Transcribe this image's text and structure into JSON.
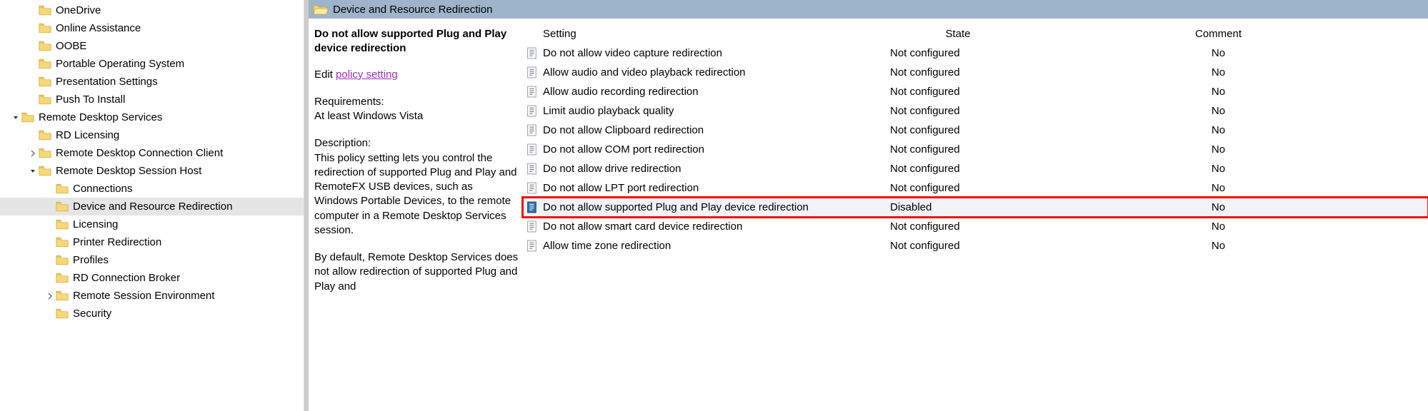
{
  "tree": [
    {
      "indent": 1,
      "exp": "none",
      "label": "OneDrive"
    },
    {
      "indent": 1,
      "exp": "none",
      "label": "Online Assistance"
    },
    {
      "indent": 1,
      "exp": "none",
      "label": "OOBE"
    },
    {
      "indent": 1,
      "exp": "none",
      "label": "Portable Operating System"
    },
    {
      "indent": 1,
      "exp": "none",
      "label": "Presentation Settings"
    },
    {
      "indent": 1,
      "exp": "none",
      "label": "Push To Install"
    },
    {
      "indent": 0,
      "exp": "open",
      "label": "Remote Desktop Services"
    },
    {
      "indent": 1,
      "exp": "none",
      "label": "RD Licensing"
    },
    {
      "indent": 1,
      "exp": "closed",
      "label": "Remote Desktop Connection Client"
    },
    {
      "indent": 1,
      "exp": "open",
      "label": "Remote Desktop Session Host"
    },
    {
      "indent": 2,
      "exp": "none",
      "label": "Connections"
    },
    {
      "indent": 2,
      "exp": "none",
      "label": "Device and Resource Redirection",
      "selected": true
    },
    {
      "indent": 2,
      "exp": "none",
      "label": "Licensing"
    },
    {
      "indent": 2,
      "exp": "none",
      "label": "Printer Redirection"
    },
    {
      "indent": 2,
      "exp": "none",
      "label": "Profiles"
    },
    {
      "indent": 2,
      "exp": "none",
      "label": "RD Connection Broker"
    },
    {
      "indent": 2,
      "exp": "closed",
      "label": "Remote Session Environment"
    },
    {
      "indent": 2,
      "exp": "none",
      "label": "Security"
    }
  ],
  "header": {
    "title": "Device and Resource Redirection"
  },
  "desc": {
    "title": "Do not allow supported Plug and Play device redirection",
    "edit_prefix": "Edit ",
    "edit_link": "policy setting",
    "req_label": "Requirements:",
    "req_text": "At least Windows Vista",
    "desc_label": "Description:",
    "desc_text": "This policy setting lets you control the redirection of supported Plug and Play and RemoteFX USB devices, such as Windows Portable Devices, to the remote computer in a Remote Desktop Services session.",
    "desc_text2": "By default, Remote Desktop Services does not allow redirection of supported Plug and Play and"
  },
  "list": {
    "cols": {
      "setting": "Setting",
      "state": "State",
      "comment": "Comment"
    },
    "rows": [
      {
        "setting": "Do not allow video capture redirection",
        "state": "Not configured",
        "comment": "No"
      },
      {
        "setting": "Allow audio and video playback redirection",
        "state": "Not configured",
        "comment": "No"
      },
      {
        "setting": "Allow audio recording redirection",
        "state": "Not configured",
        "comment": "No"
      },
      {
        "setting": "Limit audio playback quality",
        "state": "Not configured",
        "comment": "No"
      },
      {
        "setting": "Do not allow Clipboard redirection",
        "state": "Not configured",
        "comment": "No"
      },
      {
        "setting": "Do not allow COM port redirection",
        "state": "Not configured",
        "comment": "No"
      },
      {
        "setting": "Do not allow drive redirection",
        "state": "Not configured",
        "comment": "No"
      },
      {
        "setting": "Do not allow LPT port redirection",
        "state": "Not configured",
        "comment": "No"
      },
      {
        "setting": "Do not allow supported Plug and Play device redirection",
        "state": "Disabled",
        "comment": "No",
        "selected": true,
        "highlighted": true
      },
      {
        "setting": "Do not allow smart card device redirection",
        "state": "Not configured",
        "comment": "No"
      },
      {
        "setting": "Allow time zone redirection",
        "state": "Not configured",
        "comment": "No"
      }
    ]
  }
}
